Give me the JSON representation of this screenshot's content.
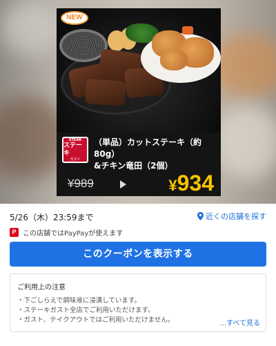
{
  "coupon": {
    "badge": "NEW",
    "logo": {
      "line1": "STEAK",
      "line2": "ステーキ",
      "line3": "ガスト"
    },
    "title_line1": "（単品）カットステーキ（約80g）",
    "title_line2": "&チキン竜田（2個）",
    "old_price": "¥989",
    "new_price_symbol": "¥",
    "new_price_value": "934"
  },
  "details": {
    "deadline": "5/26（木）23:59まで",
    "nearby_store_label": "近くの店舗を探す",
    "paypay_note": "この店舗ではPayPayが使えます",
    "show_coupon_button": "このクーポンを表示する",
    "notes": {
      "heading": "ご利用上の注意",
      "items": [
        "・下ごしらえで調味液に浸漬しています。",
        "・ステーキガスト全店でご利用いただけます。",
        "・ガスト、テイクアウトではご利用いただけません。"
      ],
      "see_all": "...すべて見る"
    }
  },
  "colors": {
    "accent_blue": "#1f72e3",
    "price_yellow": "#f5c400",
    "paypay_red": "#e0001e",
    "logo_red": "#c8102e"
  },
  "icons": [
    "location-pin-icon",
    "paypay-icon",
    "play-arrow-icon"
  ]
}
